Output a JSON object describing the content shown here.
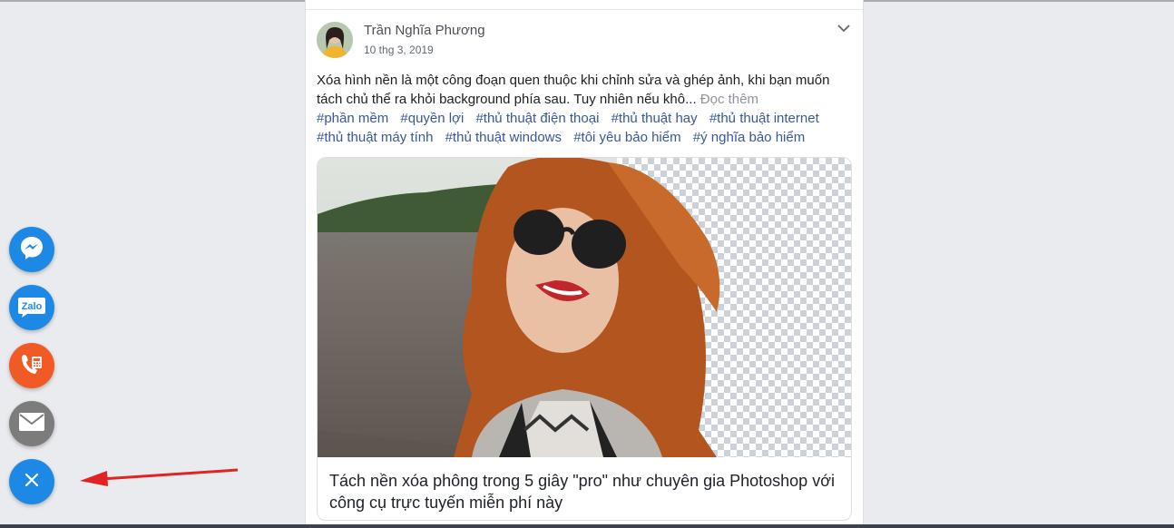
{
  "post": {
    "author": "Trần Nghĩa Phương",
    "date": "10 thg 3, 2019",
    "text": "Xóa hình nền là một công đoạn quen thuộc khi chỉnh sửa và ghép ảnh, khi bạn muốn tách chủ thể ra khỏi background phía sau. Tuy nhiên nếu khô...",
    "read_more": "Đọc thêm",
    "tags": [
      "#phần mềm",
      "#quyền lợi",
      "#thủ thuật điện thoại",
      "#thủ thuật hay",
      "#thủ thuật internet",
      "#thủ thuật máy tính",
      "#thủ thuật windows",
      "#tôi yêu bảo hiểm",
      "#ý nghĩa bảo hiểm"
    ],
    "card_title": "Tách nền xóa phông trong 5 giây \"pro\" như chuyên gia Photoshop với công cụ trực tuyến miễn phí này"
  },
  "floating_buttons": {
    "messenger": {
      "icon": "messenger-icon",
      "color": "#1e88e5"
    },
    "zalo": {
      "icon": "zalo-icon",
      "label": "Zalo",
      "color": "#1e88e5"
    },
    "phone": {
      "icon": "phone-icon",
      "color": "#f15a24"
    },
    "email": {
      "icon": "mail-icon",
      "color": "#7c7c7c"
    },
    "close": {
      "icon": "close-icon",
      "color": "#1e88e5"
    }
  },
  "colors": {
    "background": "#e9ebee",
    "hashtag": "#385898",
    "annotation_arrow": "#e02424"
  }
}
